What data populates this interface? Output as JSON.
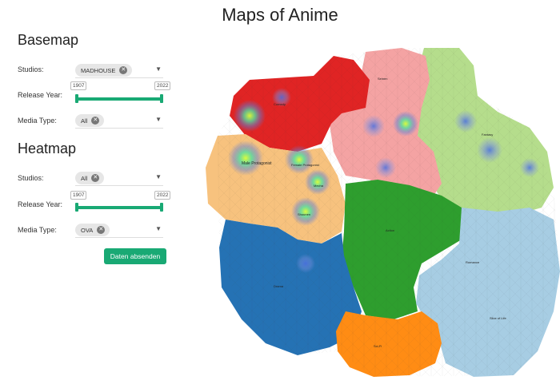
{
  "title": "Maps of Anime",
  "basemap": {
    "heading": "Basemap",
    "studios_label": "Studios:",
    "studios_value": "MADHOUSE",
    "year_label": "Release Year:",
    "year_min": "1907",
    "year_max": "2022",
    "media_label": "Media Type:",
    "media_value": "All"
  },
  "heatmap": {
    "heading": "Heatmap",
    "studios_label": "Studios:",
    "studios_value": "All",
    "year_label": "Release Year:",
    "year_min": "1907",
    "year_max": "2022",
    "media_label": "Media Type:",
    "media_value": "OVA"
  },
  "submit_label": "Daten absenden",
  "map": {
    "region_colors": {
      "red": "#e02424",
      "pink": "#f4a3a3",
      "lightgreen": "#b5dd8c",
      "orange_light": "#f7c27e",
      "blue": "#2572b4",
      "green": "#2e9e2e",
      "lightblue": "#a7cde3",
      "orange": "#ff8c14"
    },
    "labels": [
      "Male Protagonist",
      "Female Protagonist",
      "Mecha",
      "Shounen",
      "Seinen",
      "Comedy",
      "Action",
      "Romance",
      "Drama",
      "Fantasy",
      "Sci-Fi",
      "Slice of Life"
    ]
  }
}
